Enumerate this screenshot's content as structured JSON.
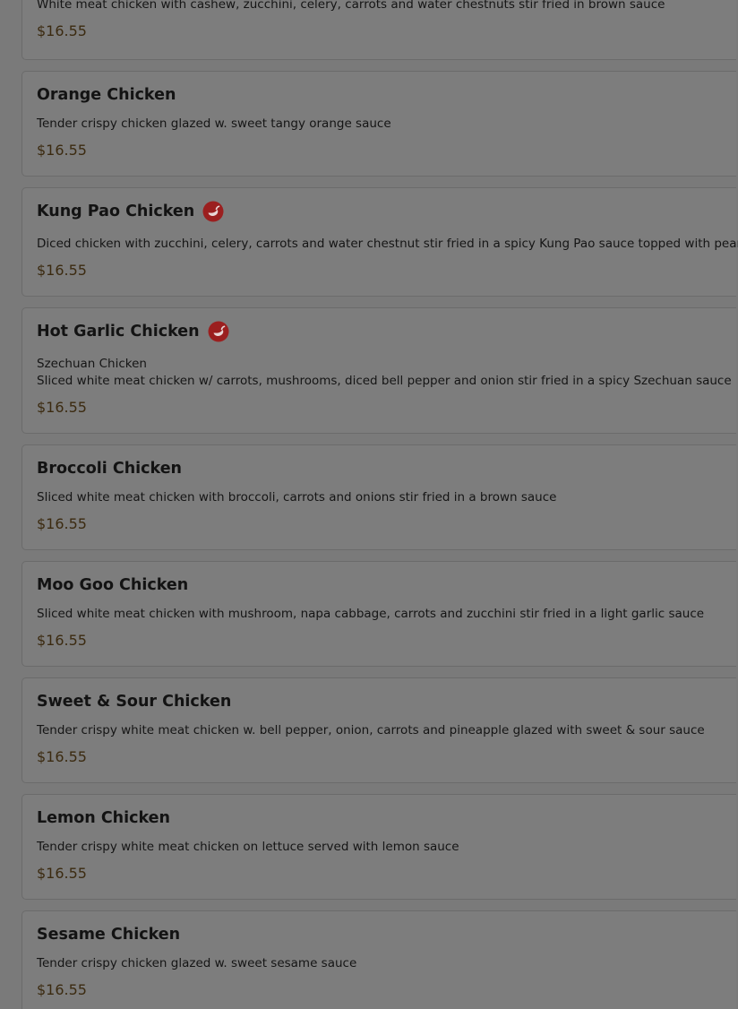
{
  "colors": {
    "overlay_background": "#7a7a7a",
    "card_background": "#7d7d7d",
    "price": "#3b2a10",
    "spicy_icon": "#b31c1c"
  },
  "menu": {
    "items": [
      {
        "name": "",
        "subtitle": "",
        "description": "White meat chicken with cashew, zucchini, celery, carrots and water chestnuts stir fried in brown sauce",
        "price": "$16.55",
        "spicy": false
      },
      {
        "name": "Orange Chicken",
        "subtitle": "",
        "description": "Tender crispy chicken glazed w. sweet tangy orange sauce",
        "price": "$16.55",
        "spicy": false
      },
      {
        "name": "Kung Pao Chicken",
        "subtitle": "",
        "description": "Diced chicken with zucchini, celery, carrots and water chestnut stir fried in a spicy Kung Pao sauce topped with peanuts",
        "price": "$16.55",
        "spicy": true,
        "icon": "chili-pepper-icon"
      },
      {
        "name": "Hot Garlic Chicken",
        "subtitle": "Szechuan Chicken",
        "description": "Sliced white meat chicken w/ carrots, mushrooms, diced bell pepper and onion stir fried in a spicy Szechuan sauce",
        "price": "$16.55",
        "spicy": true,
        "icon": "chili-pepper-icon"
      },
      {
        "name": "Broccoli Chicken",
        "subtitle": "",
        "description": "Sliced white meat chicken with broccoli, carrots and onions stir fried in a brown sauce",
        "price": "$16.55",
        "spicy": false
      },
      {
        "name": "Moo Goo Chicken",
        "subtitle": "",
        "description": "Sliced white meat chicken with mushroom, napa cabbage, carrots and zucchini stir fried in a light garlic sauce",
        "price": "$16.55",
        "spicy": false
      },
      {
        "name": "Sweet & Sour Chicken",
        "subtitle": "",
        "description": "Tender crispy white meat chicken w. bell pepper, onion, carrots and pineapple glazed with sweet & sour sauce",
        "price": "$16.55",
        "spicy": false
      },
      {
        "name": "Lemon Chicken",
        "subtitle": "",
        "description": "Tender crispy white meat chicken on lettuce served with lemon sauce",
        "price": "$16.55",
        "spicy": false
      },
      {
        "name": "Sesame Chicken",
        "subtitle": "",
        "description": "Tender crispy chicken glazed w. sweet sesame sauce",
        "price": "$16.55",
        "spicy": false
      }
    ]
  }
}
